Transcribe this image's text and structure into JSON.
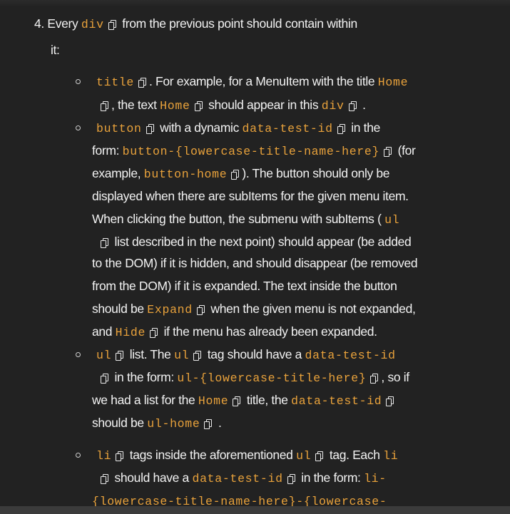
{
  "item4": {
    "number": "4.",
    "l1": {
      "a": "Every",
      "b": "div",
      "c": "from the previous point should contain within"
    },
    "l2": {
      "a": "it:"
    }
  },
  "title_item": {
    "l1": {
      "a": "title",
      "b": ". For example, for a MenuItem with the title",
      "c": "Home"
    },
    "l2": {
      "a": ", the text",
      "b": "Home",
      "c": "should appear in this",
      "d": "div",
      "e": "."
    }
  },
  "button_item": {
    "l1": {
      "a": "button",
      "b": "with a dynamic",
      "c": "data-test-id",
      "d": "in the"
    },
    "l2": {
      "a": "form:",
      "b": "button-{lowercase-title-name-here}",
      "c": "(for"
    },
    "l3": {
      "a": "example,",
      "b": "button-home",
      "c": "). The button should only be"
    },
    "l4": {
      "a": "displayed when there are subItems for the given menu item."
    },
    "l5": {
      "a": "When clicking the button, the submenu with subItems (",
      "b": "ul"
    },
    "l6": {
      "a": "list described in the next point) should appear (be added"
    },
    "l7": {
      "a": "to the DOM) if it is hidden, and should disappear (be removed"
    },
    "l8": {
      "a": "from the DOM) if it is expanded. The text inside the button"
    },
    "l9": {
      "a": "should be",
      "b": "Expand",
      "c": "when the given menu is not expanded,"
    },
    "l10": {
      "a": "and",
      "b": "Hide",
      "c": "if the menu has already been expanded."
    }
  },
  "ul_item": {
    "l1": {
      "a": "ul",
      "b": "list. The",
      "c": "ul",
      "d": "tag should have a",
      "e": "data-test-id"
    },
    "l2": {
      "a": "in the form:",
      "b": "ul-{lowercase-title-here}",
      "c": ", so if"
    },
    "l3": {
      "a": "we had a list for the",
      "b": "Home",
      "c": "title, the",
      "d": "data-test-id"
    },
    "l4": {
      "a": "should be",
      "b": "ul-home",
      "c": "."
    }
  },
  "li_item": {
    "l1": {
      "a": "li",
      "b": "tags inside the aforementioned",
      "c": "ul",
      "d": "tag. Each",
      "e": "li"
    },
    "l2": {
      "a": "should have a",
      "b": "data-test-id",
      "c": "in the form:",
      "d": "li-"
    },
    "l3": {
      "a": "{lowercase-title-name-here}-{lowercase-"
    }
  },
  "icons": {
    "copy": "copy-icon",
    "bullet": "hollow-bullet"
  }
}
